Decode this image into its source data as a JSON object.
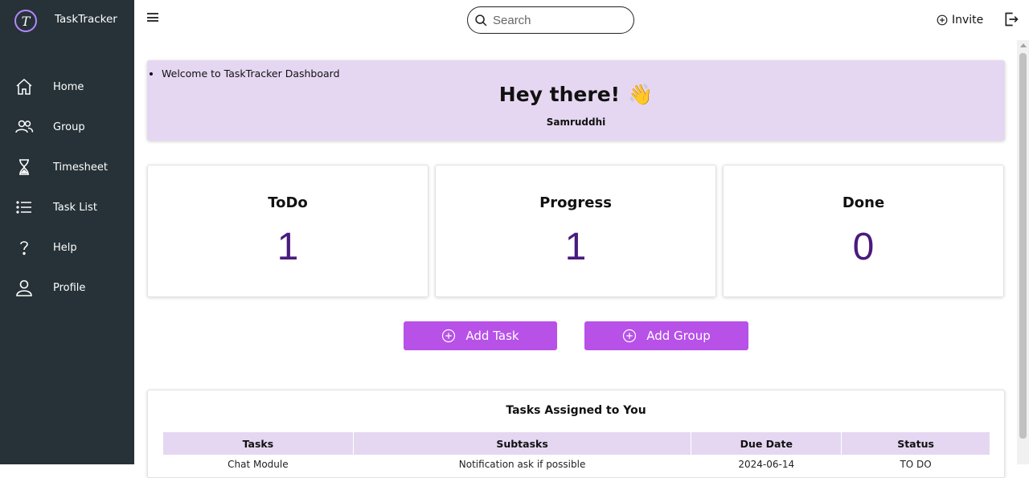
{
  "sidebar": {
    "brand_letter": "T",
    "brand_name": "TaskTracker",
    "items": [
      {
        "label": "Home",
        "icon": "home-icon"
      },
      {
        "label": "Group",
        "icon": "group-icon"
      },
      {
        "label": "Timesheet",
        "icon": "hourglass-icon"
      },
      {
        "label": "Task List",
        "icon": "list-icon"
      },
      {
        "label": "Help",
        "icon": "help-icon"
      },
      {
        "label": "Profile",
        "icon": "profile-icon"
      }
    ]
  },
  "header": {
    "search_placeholder": "Search",
    "invite_label": "Invite"
  },
  "banner": {
    "bullet": "Welcome to TaskTracker Dashboard",
    "greeting": "Hey there!",
    "wave": "👋",
    "user_name": "Samruddhi"
  },
  "stats": [
    {
      "label": "ToDo",
      "count": "1"
    },
    {
      "label": "Progress",
      "count": "1"
    },
    {
      "label": "Done",
      "count": "0"
    }
  ],
  "actions": {
    "add_task": "Add Task",
    "add_group": "Add Group"
  },
  "tasks_table": {
    "title": "Tasks Assigned to You",
    "columns": [
      "Tasks",
      "Subtasks",
      "Due Date",
      "Status"
    ],
    "rows": [
      [
        "Chat Module",
        "Notification ask if possible",
        "2024-06-14",
        "TO DO"
      ]
    ]
  },
  "colors": {
    "sidebar_bg": "#263238",
    "accent": "#b751e8",
    "banner_bg": "#e5d7f1",
    "count_color": "#4a1a7e"
  }
}
